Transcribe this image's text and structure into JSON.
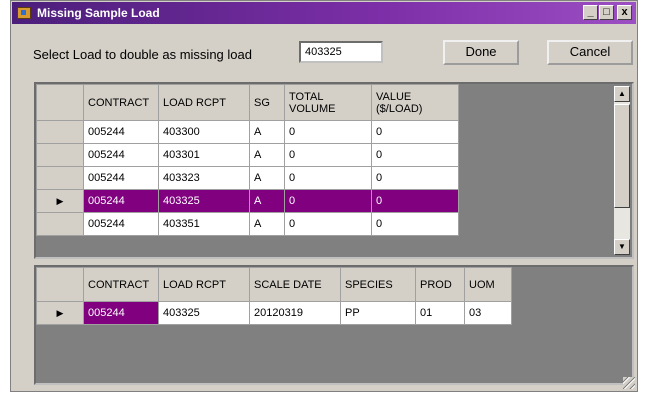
{
  "window": {
    "title": "Missing Sample Load",
    "controls": {
      "minimize": "_",
      "restore": "□",
      "close": "x"
    }
  },
  "form": {
    "select_label": "Select Load to double as missing load",
    "load_value": "403325",
    "done_label": "Done",
    "cancel_label": "Cancel"
  },
  "top_grid": {
    "headers": {
      "contract": "CONTRACT",
      "load_rcpt": "LOAD RCPT",
      "sg": "SG",
      "total_volume": "TOTAL VOLUME",
      "value": "VALUE ($/LOAD)"
    },
    "rows": [
      {
        "contract": "005244",
        "load_rcpt": "403300",
        "sg": "A",
        "total_volume": "0",
        "value": "0"
      },
      {
        "contract": "005244",
        "load_rcpt": "403301",
        "sg": "A",
        "total_volume": "0",
        "value": "0"
      },
      {
        "contract": "005244",
        "load_rcpt": "403323",
        "sg": "A",
        "total_volume": "0",
        "value": "0"
      },
      {
        "contract": "005244",
        "load_rcpt": "403325",
        "sg": "A",
        "total_volume": "0",
        "value": "0"
      },
      {
        "contract": "005244",
        "load_rcpt": "403351",
        "sg": "A",
        "total_volume": "0",
        "value": "0"
      }
    ],
    "selected_row_index": 3
  },
  "bottom_grid": {
    "headers": {
      "contract": "CONTRACT",
      "load_rcpt": "LOAD RCPT",
      "scale_date": "SCALE DATE",
      "species": "SPECIES",
      "prod": "PROD",
      "uom": "UOM"
    },
    "rows": [
      {
        "contract": "005244",
        "load_rcpt": "403325",
        "scale_date": "20120319",
        "species": "PP",
        "prod": "01",
        "uom": "03"
      }
    ]
  },
  "colors": {
    "selection": "#800080",
    "title_bar": "#5a2490",
    "grid_background": "#808080",
    "dialog_face": "#d4d0c8"
  }
}
